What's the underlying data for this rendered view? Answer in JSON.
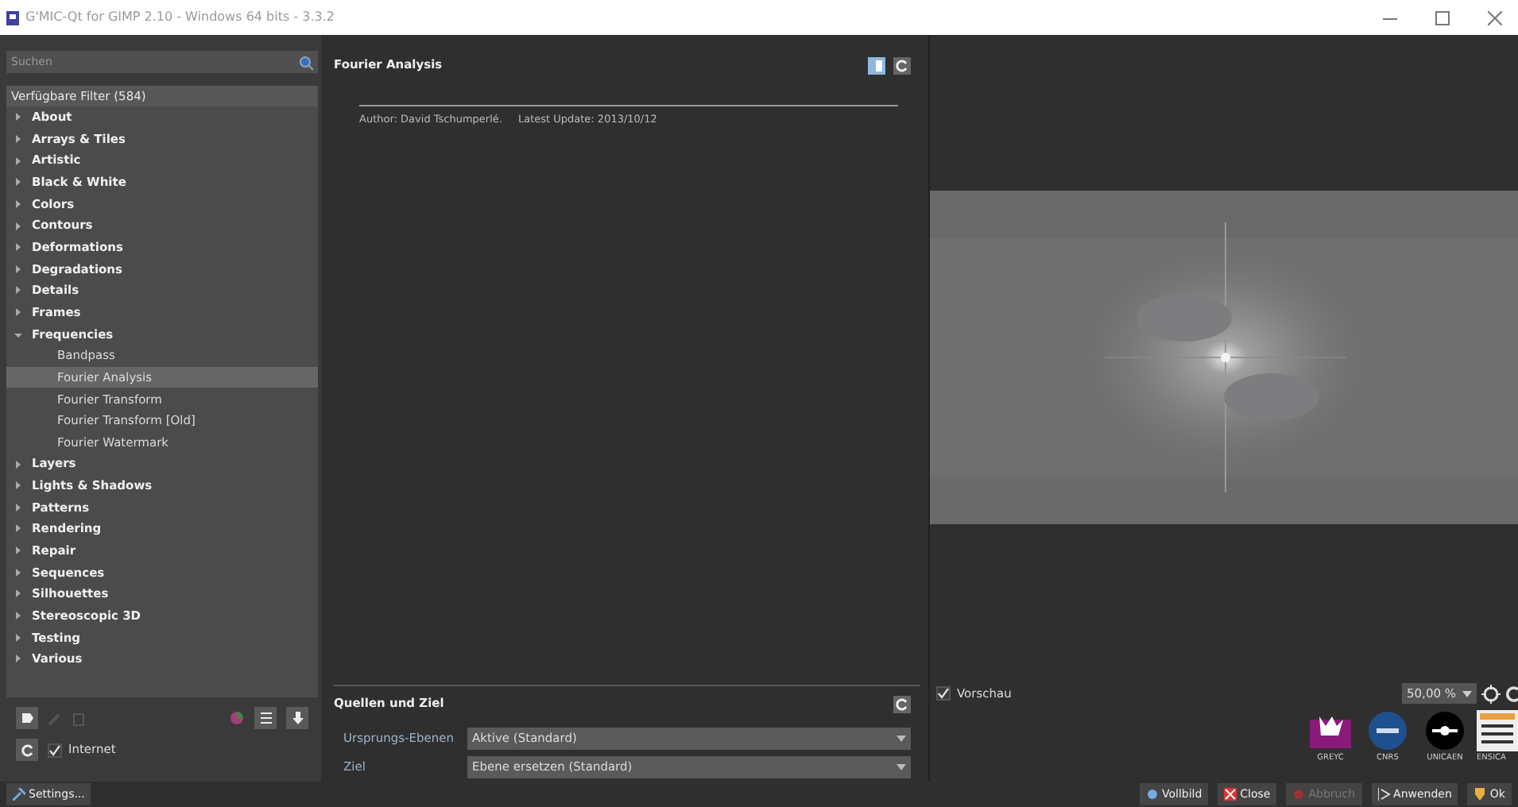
{
  "window": {
    "title": "G'MIC-Qt for GIMP 2.10 - Windows 64 bits - 3.3.2"
  },
  "filters": {
    "search": {
      "placeholder": "Suchen"
    },
    "header": "Verfügbare Filter (584)",
    "tree": [
      {
        "label": "About",
        "expanded": false,
        "selected": false
      },
      {
        "label": "Arrays & Tiles",
        "expanded": false,
        "selected": false
      },
      {
        "label": "Artistic",
        "expanded": false,
        "selected": false
      },
      {
        "label": "Black & White",
        "expanded": false,
        "selected": false
      },
      {
        "label": "Colors",
        "expanded": false,
        "selected": false
      },
      {
        "label": "Contours",
        "expanded": false,
        "selected": false
      },
      {
        "label": "Deformations",
        "expanded": false,
        "selected": false
      },
      {
        "label": "Degradations",
        "expanded": false,
        "selected": false
      },
      {
        "label": "Details",
        "expanded": false,
        "selected": false
      },
      {
        "label": "Frames",
        "expanded": false,
        "selected": false
      },
      {
        "label": "Frequencies",
        "expanded": true,
        "selected": false,
        "children": [
          {
            "label": "Bandpass",
            "selected": false
          },
          {
            "label": "Fourier Analysis",
            "selected": true
          },
          {
            "label": "Fourier Transform",
            "selected": false
          },
          {
            "label": "Fourier Transform [Old]",
            "selected": false
          },
          {
            "label": "Fourier Watermark",
            "selected": false
          }
        ]
      },
      {
        "label": "Layers",
        "expanded": false,
        "selected": false
      },
      {
        "label": "Lights & Shadows",
        "expanded": false,
        "selected": false
      },
      {
        "label": "Patterns",
        "expanded": false,
        "selected": false
      },
      {
        "label": "Rendering",
        "expanded": false,
        "selected": false
      },
      {
        "label": "Repair",
        "expanded": false,
        "selected": false
      },
      {
        "label": "Sequences",
        "expanded": false,
        "selected": false
      },
      {
        "label": "Silhouettes",
        "expanded": false,
        "selected": false
      },
      {
        "label": "Stereoscopic 3D",
        "expanded": false,
        "selected": false
      },
      {
        "label": "Testing",
        "expanded": false,
        "selected": false
      },
      {
        "label": "Various",
        "expanded": false,
        "selected": false
      }
    ],
    "internet": {
      "label": "Internet",
      "checked": true
    },
    "settings_button": "Settings..."
  },
  "filter_panel": {
    "title": "Fourier Analysis",
    "author_label": "Author:",
    "author": "David Tschumperlé.",
    "updated": "Latest Update: 2013/10/12"
  },
  "io_panel": {
    "title": "Quellen und Ziel",
    "fields": [
      {
        "label": "Ursprungs-Ebenen",
        "value": "Aktive (Standard)"
      },
      {
        "label": "Ziel",
        "value": "Ebene ersetzen (Standard)"
      }
    ]
  },
  "preview": {
    "label": "Vorschau",
    "enabled": true,
    "zoom": "50,00 %"
  },
  "logos": [
    {
      "caption": "GREYC",
      "kind": "greyc"
    },
    {
      "caption": "CNRS",
      "kind": "cnrs"
    },
    {
      "caption": "UNICAEN",
      "kind": "unicaen"
    },
    {
      "caption": "ENSICA",
      "kind": "ensicaen"
    }
  ],
  "buttons": [
    {
      "label": "Vollbild",
      "kind": "fullscreen",
      "disabled": false
    },
    {
      "label": "Close",
      "kind": "close",
      "disabled": false
    },
    {
      "label": "Abbruch",
      "kind": "cancel",
      "disabled": true
    },
    {
      "label": "Anwenden",
      "kind": "apply",
      "disabled": false
    },
    {
      "label": "Ok",
      "kind": "ok",
      "disabled": false
    }
  ]
}
